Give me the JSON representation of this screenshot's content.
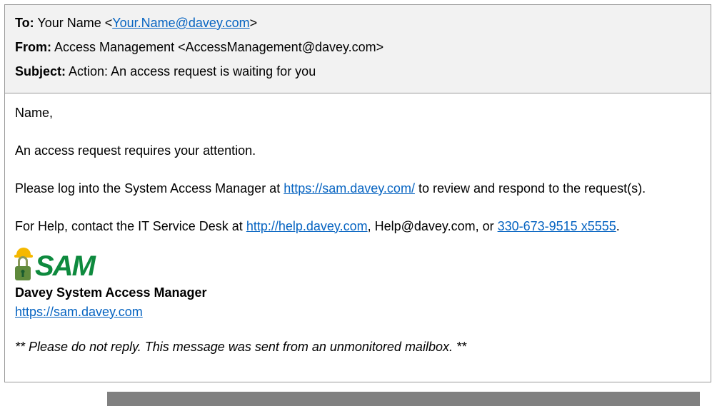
{
  "header": {
    "to_label": "To:",
    "to_name": "Your Name",
    "to_email": "Your.Name@davey.com",
    "from_label": "From:",
    "from_value": "Access Management <AccessManagement@davey.com>",
    "subject_label": "Subject:",
    "subject_value": "Action: An access request is waiting for you"
  },
  "body": {
    "greeting": "Name,",
    "intro": "An access request requires your attention.",
    "instruction_pre": "Please log into the System Access Manager at ",
    "sam_url": "https://sam.davey.com/",
    "instruction_post": " to review and respond to the request(s).",
    "help_pre": "For Help, contact the IT Service Desk at ",
    "help_url": "http://help.davey.com",
    "help_mid": ", Help@davey.com, or ",
    "help_phone": "330-673-9515 x5555",
    "help_end": "."
  },
  "logo": {
    "text": "SAM"
  },
  "signature": {
    "system_name": "Davey System Access Manager",
    "link": "https://sam.davey.com"
  },
  "disclaimer": "** Please do not reply.  This message was sent from an unmonitored mailbox. **"
}
